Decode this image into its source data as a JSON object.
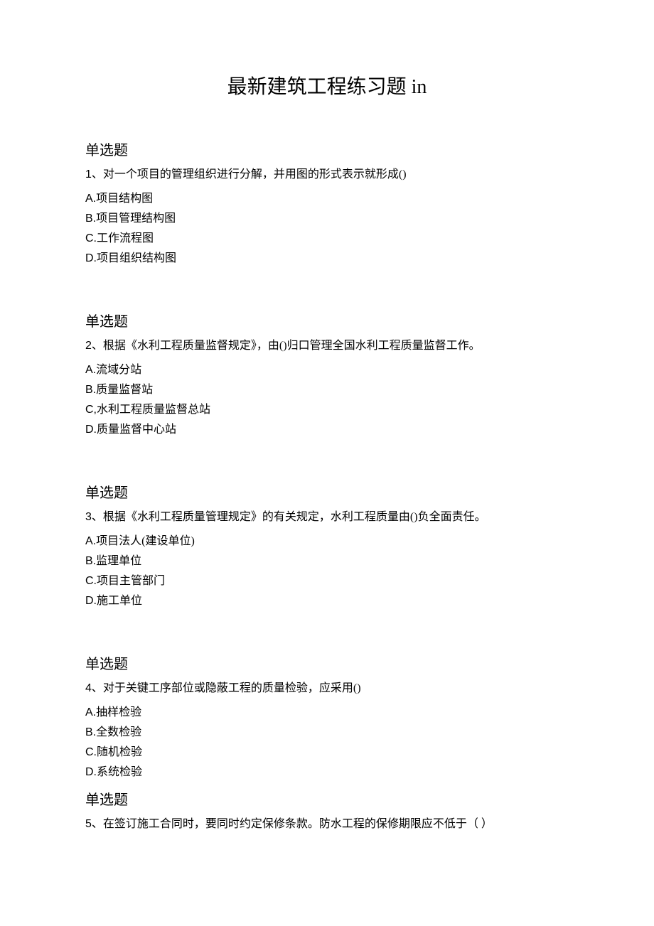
{
  "title": "最新建筑工程练习题 in",
  "questions": [
    {
      "heading": "单选题",
      "number": "1、",
      "text": "对一个项目的管理组织进行分解，并用图的形式表示就形成()",
      "options": [
        {
          "letter": "A.",
          "text": "项目结构图"
        },
        {
          "letter": "B.",
          "text": "项目管理结构图"
        },
        {
          "letter": "C.",
          "text": "工作流程图"
        },
        {
          "letter": "D.",
          "text": "项目组织结构图"
        }
      ]
    },
    {
      "heading": "单选题",
      "number": "2、",
      "text": "根据《水利工程质量监督规定》，由()归口管理全国水利工程质量监督工作。",
      "options": [
        {
          "letter": "A.",
          "text": "流域分站"
        },
        {
          "letter": "B.",
          "text": "质量监督站"
        },
        {
          "letter": "C,",
          "text": "水利工程质量监督总站"
        },
        {
          "letter": "D.",
          "text": "质量监督中心站"
        }
      ]
    },
    {
      "heading": "单选题",
      "number": "3、",
      "text": "根据《水利工程质量管理规定》的有关规定，水利工程质量由()负全面责任。",
      "options": [
        {
          "letter": "A.",
          "text": "项目法人(建设单位)"
        },
        {
          "letter": "B.",
          "text": "监理单位"
        },
        {
          "letter": "C.",
          "text": "项目主管部门"
        },
        {
          "letter": "D.",
          "text": "施工单位"
        }
      ]
    },
    {
      "heading": "单选题",
      "number": "4、",
      "text": "对于关键工序部位或隐蔽工程的质量检验，应采用()",
      "options": [
        {
          "letter": "A.",
          "text": "抽样检验"
        },
        {
          "letter": "B.",
          "text": "全数检验"
        },
        {
          "letter": "C.",
          "text": "随机检验"
        },
        {
          "letter": "D.",
          "text": "系统检验"
        }
      ]
    },
    {
      "heading": "单选题",
      "number": "5、",
      "text": "在签订施工合同时，要同时约定保修条款。防水工程的保修期限应不低于（ ）",
      "options": []
    }
  ]
}
